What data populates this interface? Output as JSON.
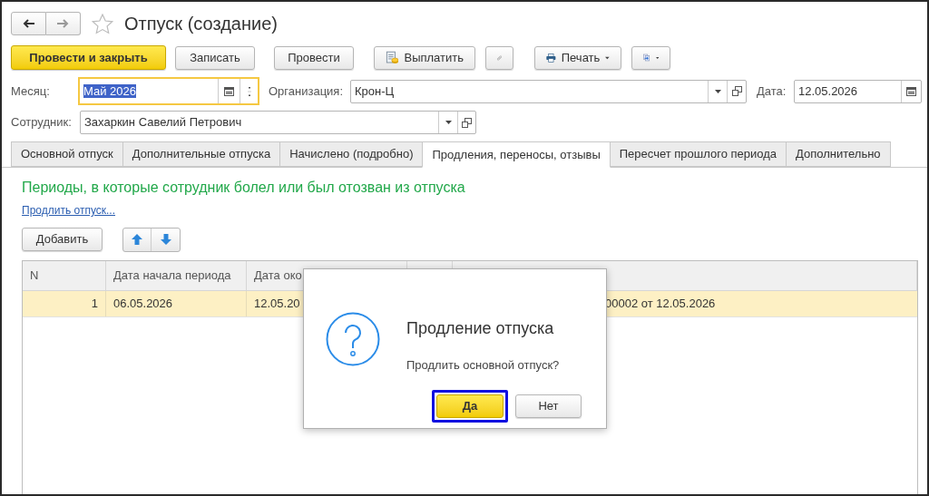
{
  "title": "Отпуск (создание)",
  "favorite": false,
  "toolbar": [
    {
      "kind": "primary",
      "label": "Провести и закрыть"
    },
    {
      "kind": "plain",
      "label": "Записать"
    },
    {
      "kind": "plain",
      "label": "Провести"
    },
    {
      "kind": "pay",
      "label": "Выплатить"
    },
    {
      "kind": "attach"
    },
    {
      "kind": "print",
      "label": "Печать"
    },
    {
      "kind": "export"
    }
  ],
  "month": {
    "label": "Месяц:",
    "value": "Май 2026",
    "focused": true
  },
  "organization": {
    "label": "Организация:",
    "value": "Крон-Ц"
  },
  "date": {
    "label": "Дата:",
    "value": "12.05.2026"
  },
  "employee": {
    "label": "Сотрудник:",
    "value": "Захаркин Савелий Петрович"
  },
  "tabs": [
    {
      "label": "Основной отпуск",
      "selected": false
    },
    {
      "label": "Дополнительные отпуска",
      "selected": false
    },
    {
      "label": "Начислено (подробно)",
      "selected": false
    },
    {
      "label": "Продления, переносы, отзывы",
      "selected": true
    },
    {
      "label": "Пересчет прошлого периода",
      "selected": false
    },
    {
      "label": "Дополнительно",
      "selected": false
    }
  ],
  "section_heading": "Периоды, в которые сотрудник болел или был отозван из отпуска",
  "extend_link": "Продлить отпуск...",
  "add_button": "Добавить",
  "table": {
    "columns": [
      "N",
      "Дата начала периода",
      "Дата око"
    ],
    "rows": [
      {
        "selected": true,
        "cells": [
          "1",
          "06.05.2026",
          "12.05.20",
          "00002 от 12.05.2026"
        ]
      }
    ]
  },
  "dialog": {
    "title": "Продление отпуска",
    "message": "Продлить основной отпуск?",
    "buttons": [
      {
        "label": "Да",
        "default": true
      },
      {
        "label": "Нет",
        "default": false
      }
    ]
  }
}
